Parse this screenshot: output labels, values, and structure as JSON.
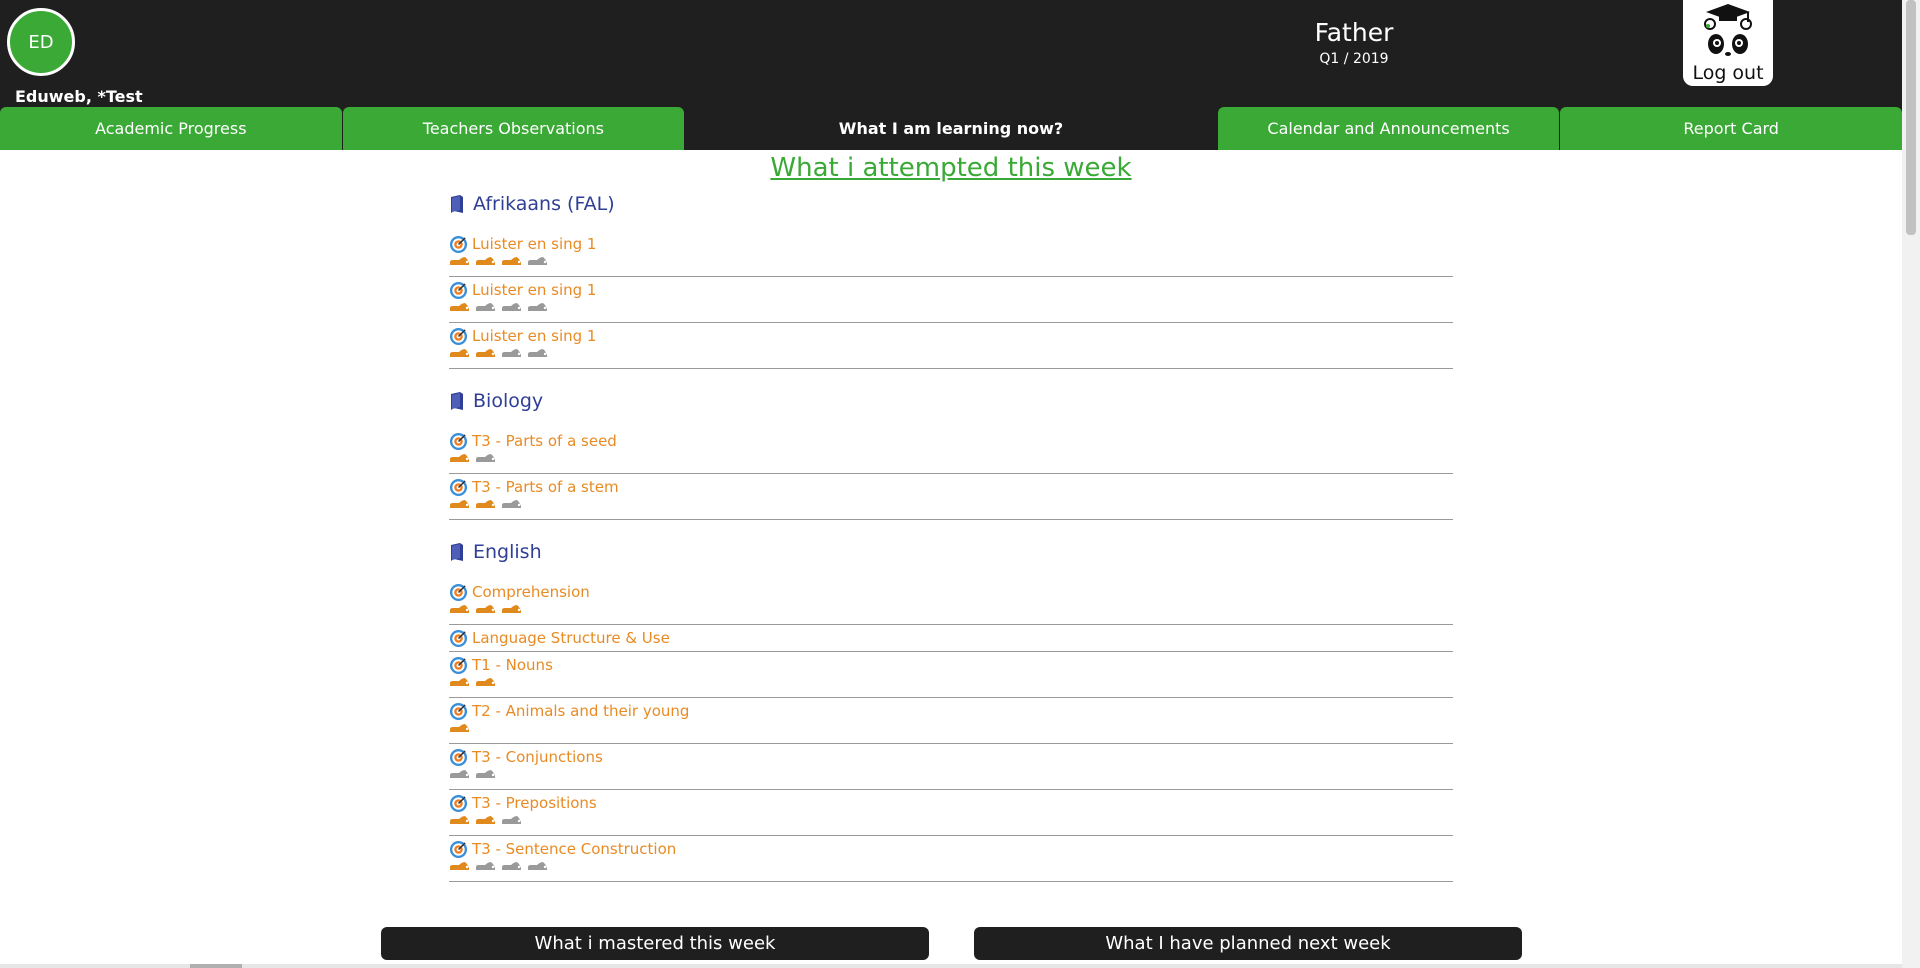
{
  "header": {
    "avatar_initials": "ED",
    "username": "Eduweb, *Test",
    "role": "Father",
    "term": "Q1 / 2019",
    "logout_label": "Log out"
  },
  "tabs": [
    {
      "label": "Academic Progress",
      "active": false
    },
    {
      "label": "Teachers Observations",
      "active": false
    },
    {
      "label": "What I am learning now?",
      "active": true
    },
    {
      "label": "Calendar and Announcements",
      "active": false
    },
    {
      "label": "Report Card",
      "active": false
    }
  ],
  "main": {
    "heading": "What i attempted this week",
    "subjects": [
      {
        "name": "Afrikaans (FAL)",
        "items": [
          {
            "label": "Luister en sing 1",
            "feet": [
              1,
              1,
              1,
              0
            ]
          },
          {
            "label": "Luister en sing 1",
            "feet": [
              1,
              0,
              0,
              0
            ]
          },
          {
            "label": "Luister en sing 1",
            "feet": [
              1,
              1,
              0,
              0
            ]
          }
        ]
      },
      {
        "name": "Biology",
        "items": [
          {
            "label": "T3 - Parts of a seed",
            "feet": [
              1,
              0
            ]
          },
          {
            "label": "T3 - Parts of a stem",
            "feet": [
              1,
              1,
              0
            ]
          }
        ]
      },
      {
        "name": "English",
        "items": [
          {
            "label": "Comprehension",
            "feet": [
              1,
              1,
              1
            ]
          },
          {
            "label": "Language Structure & Use",
            "feet": []
          },
          {
            "label": "T1 - Nouns",
            "feet": [
              1,
              1
            ]
          },
          {
            "label": "T2 - Animals and their young",
            "feet": [
              1
            ]
          },
          {
            "label": "T3 - Conjunctions",
            "feet": [
              0,
              0
            ]
          },
          {
            "label": "T3 - Prepositions",
            "feet": [
              1,
              1,
              0
            ]
          },
          {
            "label": "T3 - Sentence Construction",
            "feet": [
              1,
              0,
              0,
              0
            ]
          }
        ]
      }
    ]
  },
  "footer": {
    "mastered_label": "What i mastered this week",
    "planned_label": "What I have planned next week"
  },
  "colors": {
    "header_bg": "#1f1f1f",
    "tab_green": "#3aa935",
    "subject_blue": "#2f3f96",
    "item_orange": "#e88b25",
    "foot_done": "#e08a1e",
    "foot_pending": "#9a9a9a"
  },
  "icons": {
    "subject": "book-icon",
    "item": "target-icon",
    "progress": "foot-icon",
    "logout": "panda-graduate-icon"
  }
}
